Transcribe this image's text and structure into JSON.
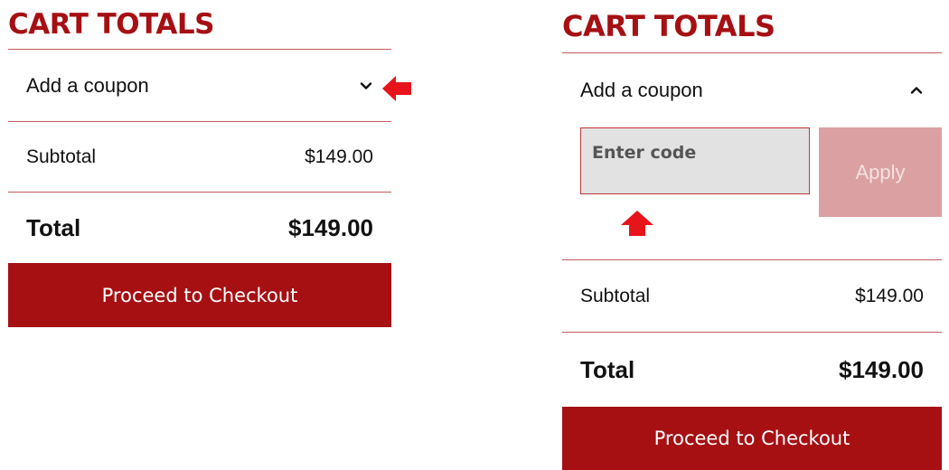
{
  "collapsed": {
    "title": "CART TOTALS",
    "coupon_label": "Add a coupon",
    "subtotal_label": "Subtotal",
    "subtotal_value": "$149.00",
    "total_label": "Total",
    "total_value": "$149.00",
    "checkout_label": "Proceed to Checkout"
  },
  "expanded": {
    "title": "CART TOTALS",
    "coupon_label": "Add a coupon",
    "code_placeholder": "Enter code",
    "apply_label": "Apply",
    "subtotal_label": "Subtotal",
    "subtotal_value": "$149.00",
    "total_label": "Total",
    "total_value": "$149.00",
    "checkout_label": "Proceed to Checkout"
  },
  "icons": {
    "collapsed_toggle": "chevron-down-icon",
    "expanded_toggle": "chevron-up-icon",
    "annotation_left": "arrow-left-icon",
    "annotation_up": "arrow-up-icon"
  },
  "colors": {
    "brand": "#a61013",
    "divider": "#c45a5c",
    "apply_disabled": "#dba0a1",
    "input_bg": "#e2e2e2",
    "annotation": "#e8141b"
  }
}
